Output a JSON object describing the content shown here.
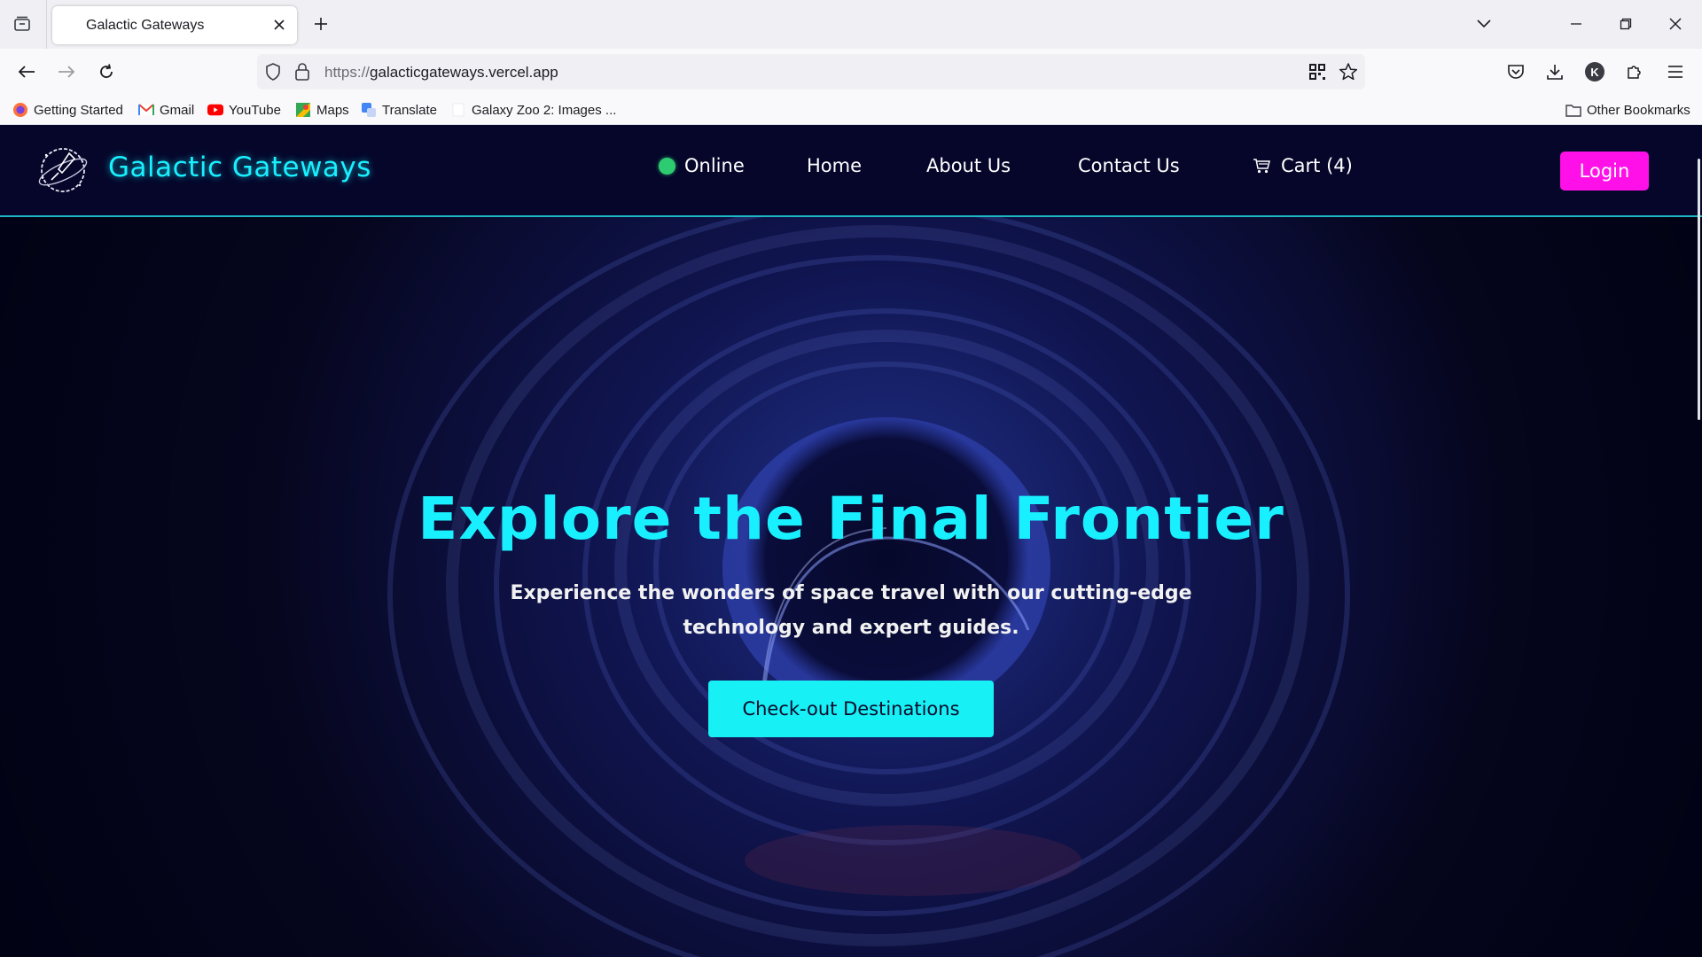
{
  "browser": {
    "tab": {
      "title": "Galactic Gateways"
    },
    "address_bar": {
      "protocol": "https://",
      "host": "galacticgateways.vercel.app"
    },
    "bookmarks": [
      {
        "label": "Getting Started",
        "icon": "firefox-icon"
      },
      {
        "label": "Gmail",
        "icon": "gmail-icon"
      },
      {
        "label": "YouTube",
        "icon": "youtube-icon"
      },
      {
        "label": "Maps",
        "icon": "maps-icon"
      },
      {
        "label": "Translate",
        "icon": "translate-icon"
      },
      {
        "label": "Galaxy Zoo 2: Images ...",
        "icon": "page-icon"
      }
    ],
    "other_bookmarks": "Other Bookmarks",
    "profile_initial": "K"
  },
  "site": {
    "brand": "Galactic Gateways",
    "nav": {
      "online": "Online",
      "home": "Home",
      "about": "About Us",
      "contact": "Contact Us",
      "cart": "Cart (4)"
    },
    "login": "Login",
    "hero": {
      "title": "Explore the Final Frontier",
      "subtitle": "Experience the wonders of space travel with our cutting-edge technology and expert guides.",
      "cta": "Check-out Destinations"
    },
    "colors": {
      "accent_cyan": "#19f0ff",
      "login_magenta": "#ff10e8",
      "online_green": "#2ecc71",
      "header_bg": "#05062a"
    }
  }
}
